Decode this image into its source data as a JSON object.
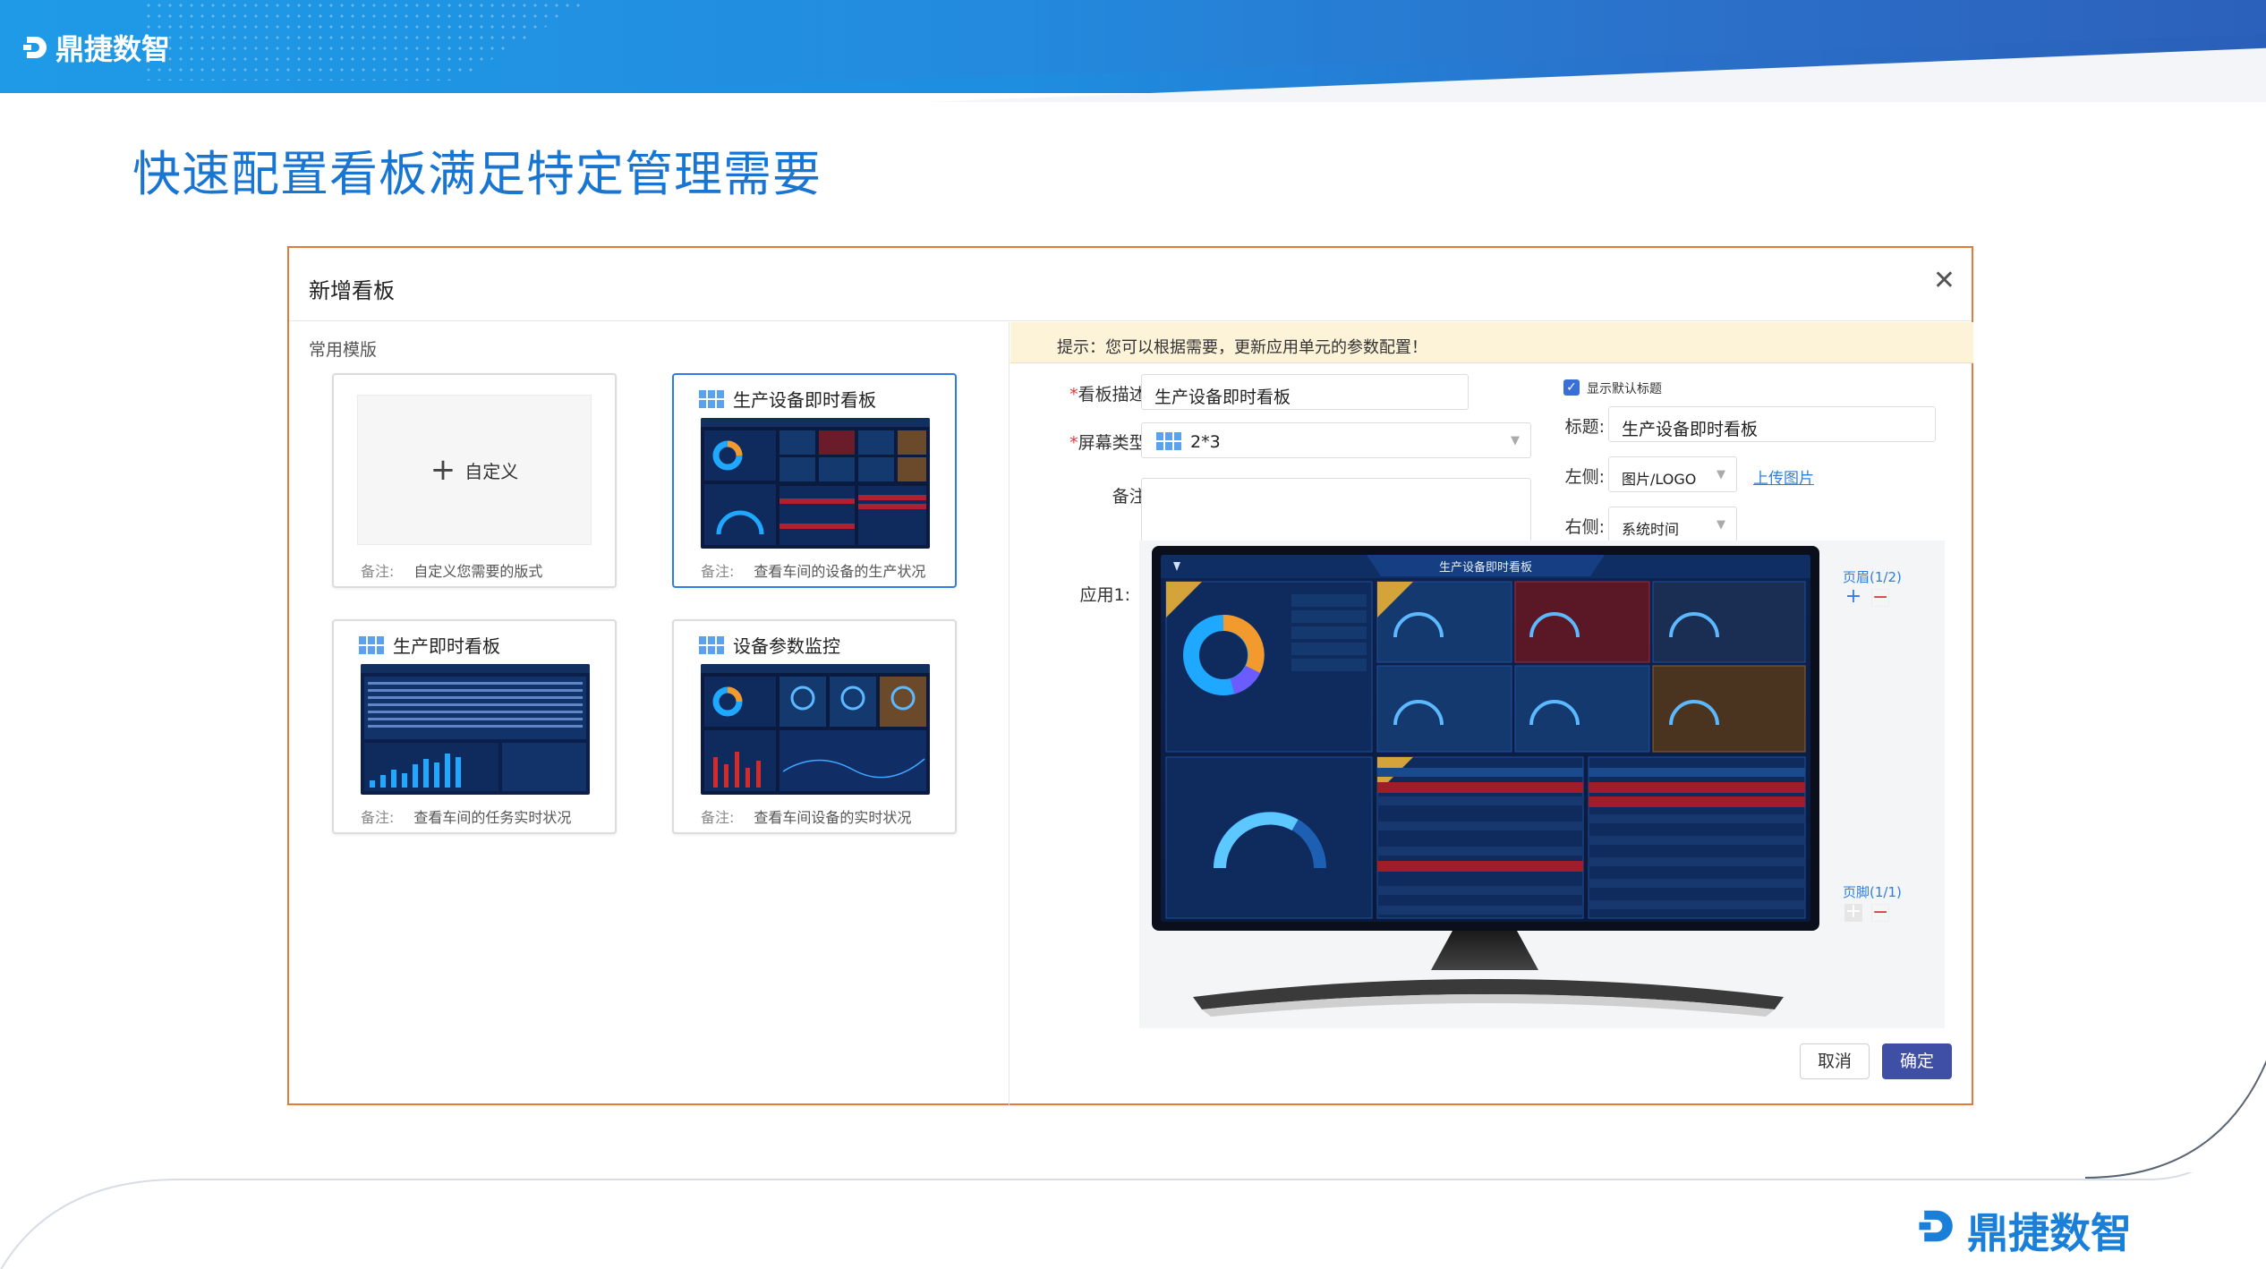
{
  "brand": {
    "name": "鼎捷数智"
  },
  "page": {
    "title": "快速配置看板满足特定管理需要"
  },
  "dialog": {
    "title": "新增看板",
    "close_icon": "close-icon",
    "left": {
      "section_label": "常用模版",
      "note_key": "备注:",
      "templates": [
        {
          "title": "",
          "custom_label": "自定义",
          "note": "自定义您需要的版式"
        },
        {
          "title": "生产设备即时看板",
          "note": "查看车间的设备的生产状况",
          "selected": true
        },
        {
          "title": "生产即时看板",
          "note": "查看车间的任务实时状况"
        },
        {
          "title": "设备参数监控",
          "note": "查看车间设备的实时状况"
        }
      ]
    },
    "right": {
      "hint": "提示：您可以根据需要，更新应用单元的参数配置！",
      "desc_label": "看板描述:",
      "desc_value": "生产设备即时看板",
      "screen_type_label": "屏幕类型:",
      "screen_type_value": "2*3",
      "remark_label": "备注:",
      "remark_value": "",
      "show_default_title": "显示默认标题",
      "title_label": "标题:",
      "title_value": "生产设备即时看板",
      "left_label": "左侧:",
      "left_value": "图片/LOGO",
      "upload_link": "上传图片",
      "right_label": "右侧:",
      "right_value": "系统时间",
      "app_label": "应用1:",
      "header_label": "页眉(1/2)",
      "footer_label": "页脚(1/1)",
      "screen_title": "生产设备即时看板",
      "cancel": "取消",
      "confirm": "确定"
    }
  },
  "colors": {
    "accent": "#1875d1",
    "dialog_border": "#e07b3a",
    "confirm_bg": "#3f4fa6",
    "hint_bg": "#fdf3d8"
  }
}
